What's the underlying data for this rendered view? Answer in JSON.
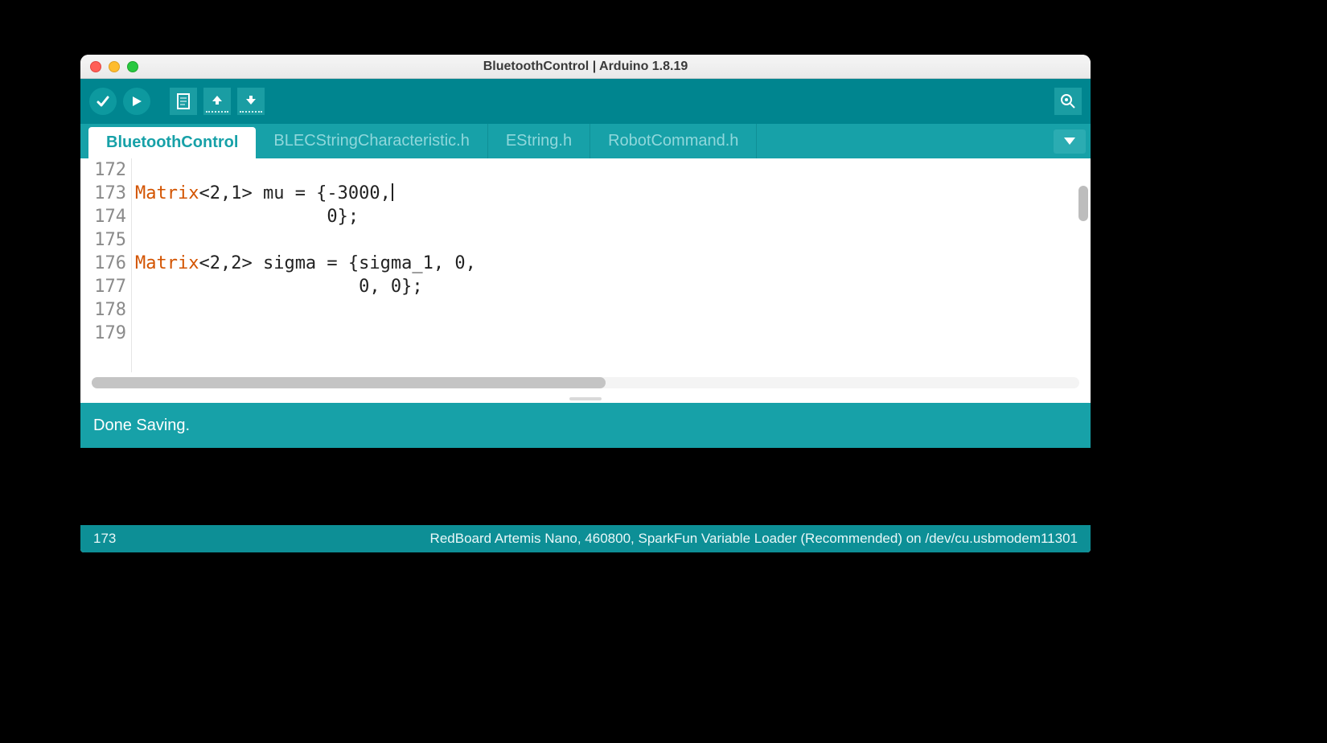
{
  "window": {
    "title": "BluetoothControl | Arduino 1.8.19"
  },
  "tabs": [
    {
      "label": "BluetoothControl",
      "active": true
    },
    {
      "label": "BLECStringCharacteristic.h",
      "active": false
    },
    {
      "label": "EString.h",
      "active": false
    },
    {
      "label": "RobotCommand.h",
      "active": false
    }
  ],
  "editor": {
    "lines": [
      {
        "num": "172",
        "segments": [
          {
            "t": "",
            "c": ""
          }
        ]
      },
      {
        "num": "173",
        "segments": [
          {
            "t": "Matrix",
            "c": "kw"
          },
          {
            "t": "<2,1> mu = {-3000,",
            "c": ""
          }
        ],
        "cursor": true
      },
      {
        "num": "174",
        "segments": [
          {
            "t": "                  0};",
            "c": ""
          }
        ]
      },
      {
        "num": "175",
        "segments": [
          {
            "t": "",
            "c": ""
          }
        ]
      },
      {
        "num": "176",
        "segments": [
          {
            "t": "Matrix",
            "c": "kw"
          },
          {
            "t": "<2,2> sigma = {sigma_1, 0,",
            "c": ""
          }
        ]
      },
      {
        "num": "177",
        "segments": [
          {
            "t": "                     0, 0};",
            "c": ""
          }
        ]
      },
      {
        "num": "178",
        "segments": [
          {
            "t": "",
            "c": ""
          }
        ]
      },
      {
        "num": "179",
        "segments": [
          {
            "t": "",
            "c": ""
          }
        ]
      }
    ]
  },
  "status": {
    "message": "Done Saving.",
    "line_indicator": "173",
    "board_info": "RedBoard Artemis Nano, 460800, SparkFun Variable Loader (Recommended) on /dev/cu.usbmodem11301"
  },
  "colors": {
    "teal": "#17a1a8",
    "teal_dark": "#00858f",
    "keyword": "#d35400"
  }
}
